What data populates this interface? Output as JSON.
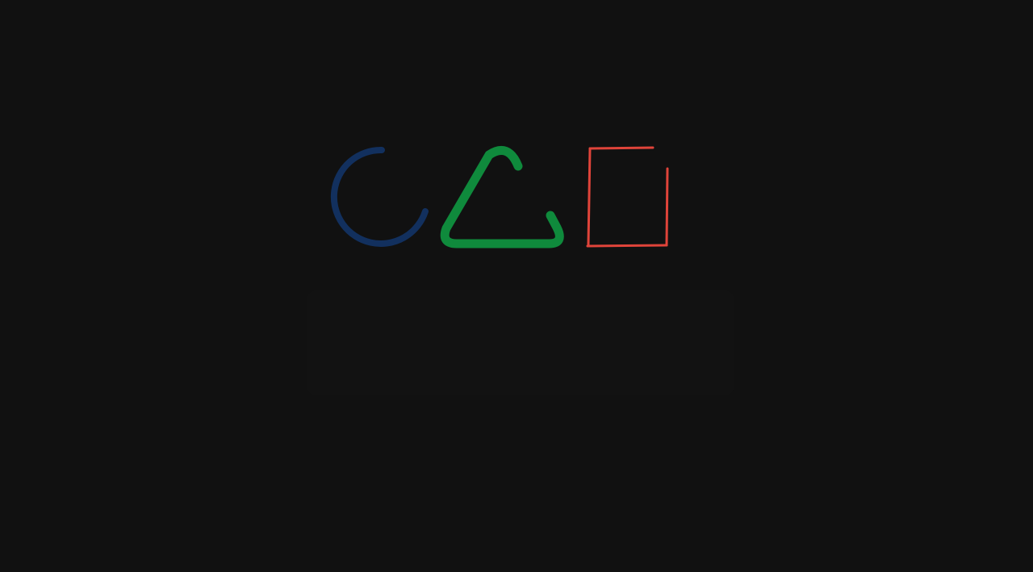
{
  "logo": {
    "shapes": [
      {
        "name": "circle",
        "color": "#12305e"
      },
      {
        "name": "triangle",
        "color": "#0f8a3c"
      },
      {
        "name": "square",
        "color": "#e0443a"
      }
    ]
  },
  "background_color": "#111111"
}
